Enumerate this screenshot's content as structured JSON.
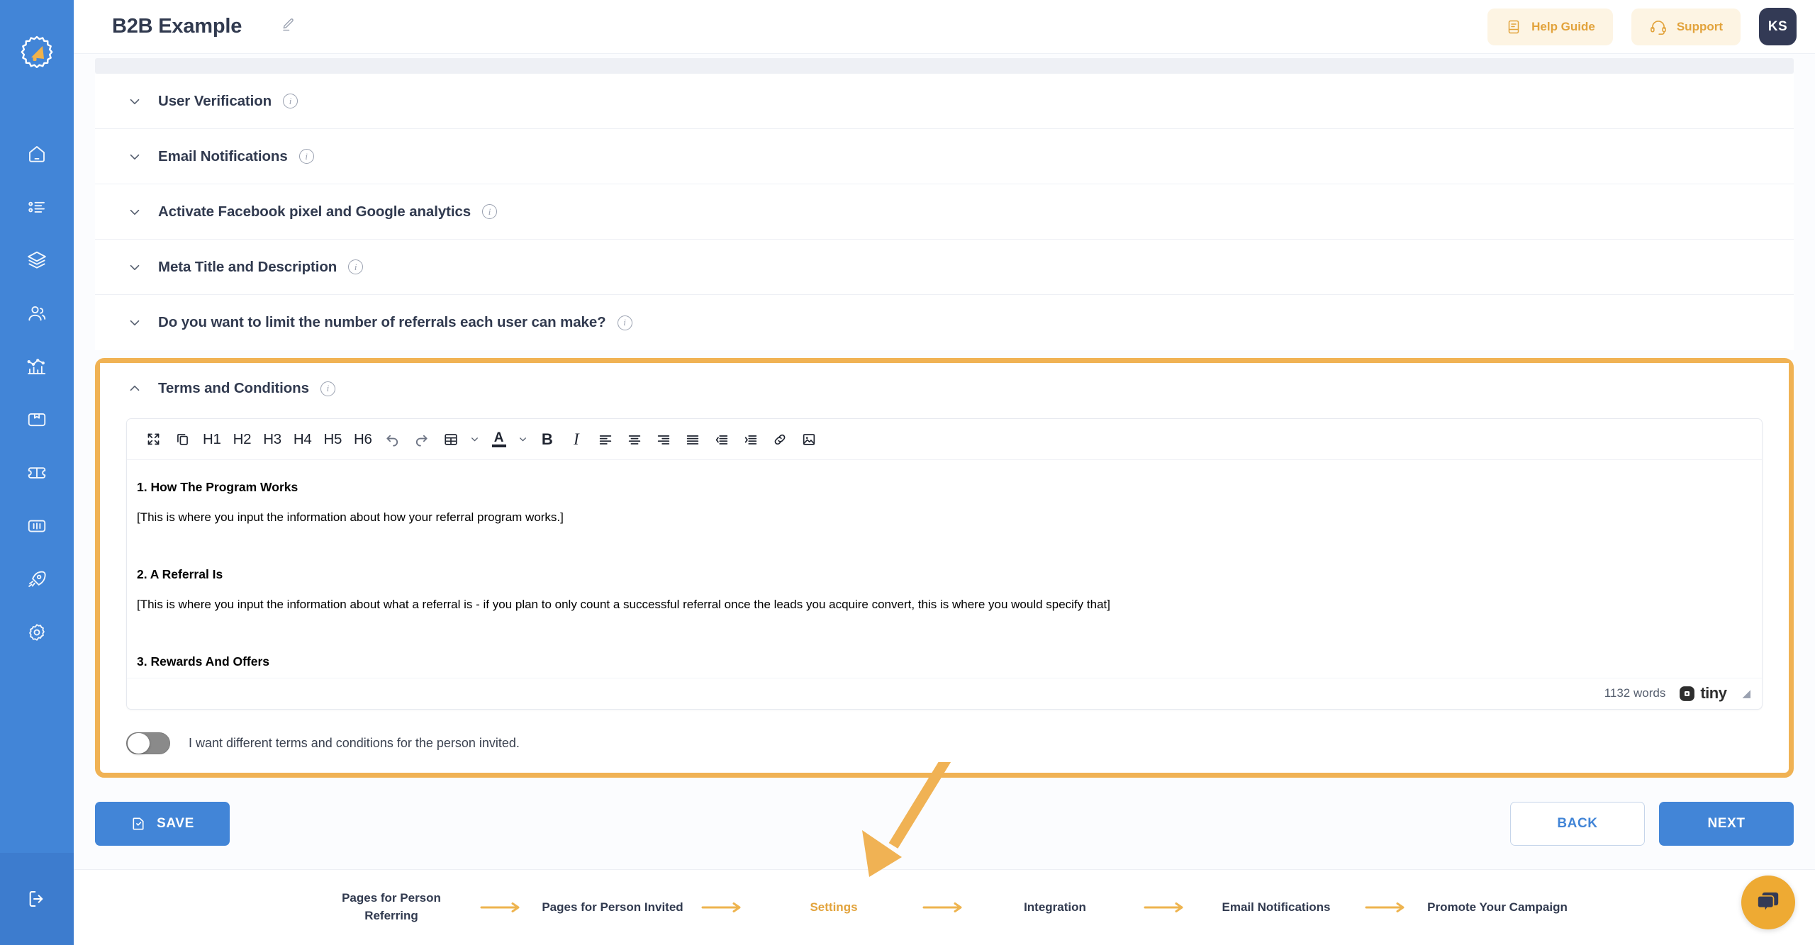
{
  "app": {
    "brand_icon": "megaphone-logo-icon",
    "sidebar_bg": "#4285d7",
    "accent_orange": "#e2a33c",
    "accent_blue": "#4285d7"
  },
  "sidebar": {
    "items": [
      {
        "name": "dashboard",
        "icon": "home-icon"
      },
      {
        "name": "campaigns-list",
        "icon": "list-icon"
      },
      {
        "name": "layers",
        "icon": "layers-icon"
      },
      {
        "name": "referrals",
        "icon": "users-icon"
      },
      {
        "name": "analytics",
        "icon": "chart-icon"
      },
      {
        "name": "products",
        "icon": "box-icon"
      },
      {
        "name": "coupons",
        "icon": "ticket-icon"
      },
      {
        "name": "widgets",
        "icon": "columns-icon"
      },
      {
        "name": "launch",
        "icon": "rocket-icon"
      },
      {
        "name": "settings",
        "icon": "gear-icon"
      }
    ],
    "logout": {
      "name": "logout",
      "icon": "logout-icon"
    }
  },
  "header": {
    "title": "B2B Example",
    "edit_icon": "pencil-icon",
    "help_guide": {
      "label": "Help Guide",
      "icon": "book-icon"
    },
    "support": {
      "label": "Support",
      "icon": "headset-icon"
    },
    "avatar_initials": "KS"
  },
  "accordions": [
    {
      "label": "User Verification",
      "expanded": false,
      "chevron": "chevron-down-icon",
      "info": "i"
    },
    {
      "label": "Email Notifications",
      "expanded": false,
      "chevron": "chevron-down-icon",
      "info": "i"
    },
    {
      "label": "Activate Facebook pixel and Google analytics",
      "expanded": false,
      "chevron": "chevron-down-icon",
      "info": "i"
    },
    {
      "label": "Meta Title and Description",
      "expanded": false,
      "chevron": "chevron-down-icon",
      "info": "i"
    },
    {
      "label": "Do you want to limit the number of referrals each user can make?",
      "expanded": false,
      "chevron": "chevron-down-icon",
      "info": "i"
    }
  ],
  "terms_panel": {
    "label": "Terms and Conditions",
    "expanded": true,
    "chevron": "chevron-up-icon",
    "info": "i",
    "highlight_color": "#f0b254",
    "toolbar": [
      {
        "name": "fullscreen",
        "label": "",
        "icon": "fullscreen-icon"
      },
      {
        "name": "copy",
        "label": "",
        "icon": "copy-icon"
      },
      {
        "name": "heading-1",
        "label": "H1",
        "icon": "text-icon"
      },
      {
        "name": "heading-2",
        "label": "H2",
        "icon": "text-icon"
      },
      {
        "name": "heading-3",
        "label": "H3",
        "icon": "text-icon"
      },
      {
        "name": "heading-4",
        "label": "H4",
        "icon": "text-icon"
      },
      {
        "name": "heading-5",
        "label": "H5",
        "icon": "text-icon"
      },
      {
        "name": "heading-6",
        "label": "H6",
        "icon": "text-icon"
      },
      {
        "name": "undo",
        "label": "",
        "icon": "undo-icon"
      },
      {
        "name": "redo",
        "label": "",
        "icon": "redo-icon"
      },
      {
        "name": "table",
        "label": "",
        "icon": "table-icon"
      },
      {
        "name": "table-dropdown",
        "label": "",
        "icon": "chevron-down-icon"
      },
      {
        "name": "text-color",
        "label": "A",
        "icon": "text-color-icon"
      },
      {
        "name": "text-color-dropdown",
        "label": "",
        "icon": "chevron-down-icon"
      },
      {
        "name": "bold",
        "label": "B",
        "icon": "bold-icon"
      },
      {
        "name": "italic",
        "label": "I",
        "icon": "italic-icon"
      },
      {
        "name": "align-left",
        "label": "",
        "icon": "align-left-icon"
      },
      {
        "name": "align-center",
        "label": "",
        "icon": "align-center-icon"
      },
      {
        "name": "align-right",
        "label": "",
        "icon": "align-right-icon"
      },
      {
        "name": "align-justify",
        "label": "",
        "icon": "align-justify-icon"
      },
      {
        "name": "outdent",
        "label": "",
        "icon": "outdent-icon"
      },
      {
        "name": "indent",
        "label": "",
        "icon": "indent-icon"
      },
      {
        "name": "insert-link",
        "label": "",
        "icon": "link-icon"
      },
      {
        "name": "insert-image",
        "label": "",
        "icon": "image-icon"
      }
    ],
    "document": {
      "heading_1": "1. How The Program Works",
      "para_1": "[This is where you input the information about how your referral program works.]",
      "heading_2": "2. A Referral Is",
      "para_2": "[This is where you input the information about what a referral is - if you plan to only count a successful referral once the leads you acquire convert, this is where you would specify that]",
      "heading_3": "3. Rewards And Offers"
    },
    "footer": {
      "word_count": "1132 words",
      "brand": "tiny",
      "brand_icon": "tiny-logo-icon",
      "resize_handle": "resize-grip-icon"
    },
    "toggle": {
      "label": "I want different terms and conditions for the person invited.",
      "on": false
    }
  },
  "actions": {
    "save_label": "SAVE",
    "save_icon": "save-file-icon",
    "back_label": "BACK",
    "next_label": "NEXT"
  },
  "stepper": {
    "steps": [
      {
        "label": "Pages for Person Referring",
        "active": false
      },
      {
        "label": "Pages for Person Invited",
        "active": false
      },
      {
        "label": "Settings",
        "active": true
      },
      {
        "label": "Integration",
        "active": false
      },
      {
        "label": "Email Notifications",
        "active": false
      },
      {
        "label": "Promote Your Campaign",
        "active": false
      }
    ],
    "arrow_icon": "arrow-right-icon"
  },
  "chat_widget": {
    "icon": "chat-bubbles-icon",
    "color": "#eeaa33"
  },
  "annotation": {
    "arrow_icon": "annotation-arrow-icon",
    "color": "#f0b254",
    "points_to": "Settings"
  }
}
